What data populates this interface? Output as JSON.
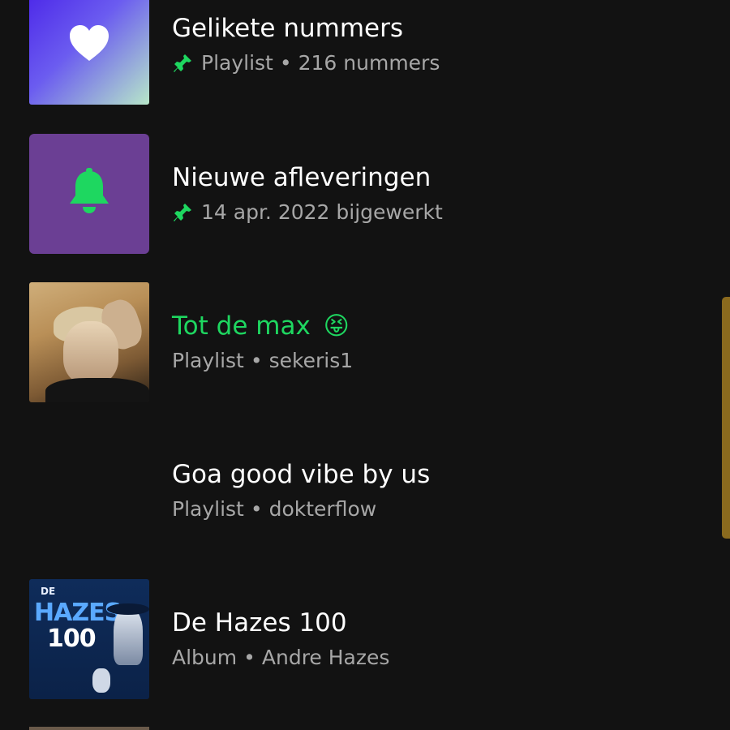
{
  "library": {
    "items": [
      {
        "title": "Gelikete nummers",
        "pinned": true,
        "sub_type": "Playlist",
        "sub_detail": "216 nummers",
        "thumb_icon": "heart-icon",
        "active": false
      },
      {
        "title": "Nieuwe afleveringen",
        "pinned": true,
        "sub_text": "14 apr. 2022 bijgewerkt",
        "thumb_icon": "bell-icon",
        "active": false
      },
      {
        "title": "Tot de max",
        "title_emoji": "😝",
        "pinned": false,
        "sub_type": "Playlist",
        "sub_detail": "sekeris1",
        "active": true
      },
      {
        "title": "Goa good vibe by us",
        "pinned": false,
        "sub_type": "Playlist",
        "sub_detail": "dokterflow",
        "active": false
      },
      {
        "title": "De Hazes 100",
        "pinned": false,
        "sub_type": "Album",
        "sub_detail": "Andre Hazes",
        "cover_text": {
          "top": "DE",
          "main": "HAZES",
          "number": "100"
        },
        "active": false
      }
    ],
    "separator": "•"
  },
  "colors": {
    "background": "#121212",
    "accent_green": "#1ed760",
    "secondary_text": "#a7a7a7",
    "episodes_tile": "#6b3f94",
    "scrollbar": "#8a6a1e"
  },
  "icons": {
    "pin": "pin-icon",
    "heart": "heart-icon",
    "bell": "bell-icon"
  }
}
